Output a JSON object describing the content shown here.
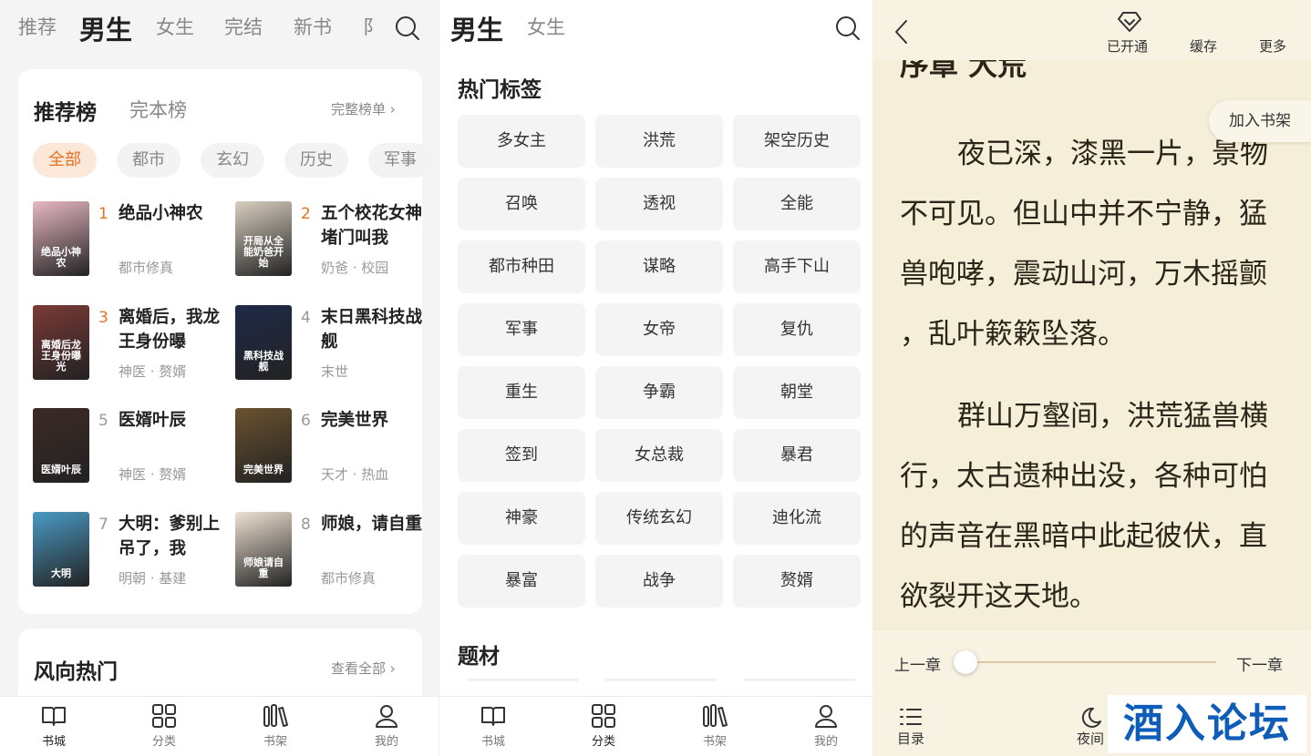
{
  "p1": {
    "tabs": [
      "推荐",
      "男生",
      "女生",
      "完结",
      "新书",
      "阝"
    ],
    "rank": {
      "title": "推荐榜",
      "title2": "完本榜",
      "more": "完整榜单"
    },
    "chips": [
      "全部",
      "都市",
      "玄幻",
      "历史",
      "军事"
    ],
    "books": [
      {
        "rank": "1",
        "title": "绝品小神农",
        "tags": "都市修真",
        "cover": "绝品小神农",
        "color": "#e8b8c2"
      },
      {
        "rank": "2",
        "title": "五个校花女神堵门叫我",
        "tags": "奶爸 · 校园",
        "cover": "开局从全能奶爸开始",
        "color": "#d9cfc0"
      },
      {
        "rank": "3",
        "title": "离婚后，我龙王身份曝",
        "tags": "神医 · 赘婿",
        "cover": "离婚后龙王身份曝光",
        "color": "#7b3a36"
      },
      {
        "rank": "4",
        "title": "末日黑科技战舰",
        "tags": "末世",
        "cover": "黑科技战舰",
        "color": "#1f2a48"
      },
      {
        "rank": "5",
        "title": "医婿叶辰",
        "tags": "神医 · 赘婿",
        "cover": "医婿叶辰",
        "color": "#3d2a26"
      },
      {
        "rank": "6",
        "title": "完美世界",
        "tags": "天才 · 热血",
        "cover": "完美世界",
        "color": "#6b5230"
      },
      {
        "rank": "7",
        "title": "大明：爹别上吊了，我",
        "tags": "明朝 · 基建",
        "cover": "大明",
        "color": "#4a9ac4"
      },
      {
        "rank": "8",
        "title": "师娘，请自重",
        "tags": "都市修真",
        "cover": "师娘请自重",
        "color": "#efe2d3"
      }
    ],
    "trend": {
      "title": "风向热门",
      "more": "查看全部"
    }
  },
  "p2": {
    "tabs": [
      "男生",
      "女生"
    ],
    "hot_title": "热门标签",
    "tags": [
      "多女主",
      "洪荒",
      "架空历史",
      "召唤",
      "透视",
      "全能",
      "都市种田",
      "谋略",
      "高手下山",
      "军事",
      "女帝",
      "复仇",
      "重生",
      "争霸",
      "朝堂",
      "签到",
      "女总裁",
      "暴君",
      "神豪",
      "传统玄幻",
      "迪化流",
      "暴富",
      "战争",
      "赘婿"
    ],
    "topic_title": "题材"
  },
  "bottom_tabs": [
    "书城",
    "分类",
    "书架",
    "我的"
  ],
  "p3": {
    "actions": [
      "已开通",
      "缓存",
      "更多"
    ],
    "add_shelf": "加入书架",
    "chapter_title": "序章 大荒",
    "lines": [
      "夜已深，漆黑一片，景物",
      "不可见。但山中并不宁静，猛",
      "兽咆哮，震动山河，万木摇颤",
      "，乱叶簌簌坠落。",
      "群山万壑间，洪荒猛兽横",
      "行，太古遗种出没，各种可怕",
      "的声音在黑暗中此起彼伏，直",
      "欲裂开这天地。"
    ],
    "prev": "上一章",
    "next": "下一章",
    "menu": "目录",
    "night": "夜间",
    "watermark": "酒入论坛",
    "progress": 0.0
  }
}
